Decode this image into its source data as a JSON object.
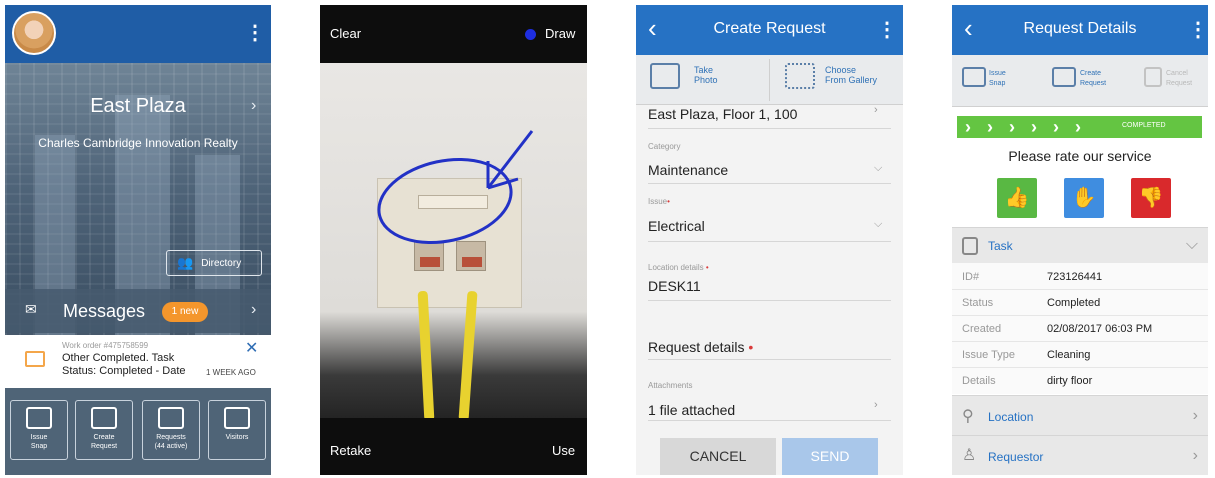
{
  "screen1": {
    "building_name": "East Plaza",
    "company": "Charles Cambridge Innovation Realty",
    "directory_label": "Directory",
    "messages_label": "Messages",
    "messages_badge": "1 new",
    "notification": {
      "work_order": "Work order #475758599",
      "line1": "Other Completed. Task",
      "line2": "Status: Completed - Date",
      "time": "1 WEEK AGO"
    },
    "tiles": [
      {
        "line1": "Issue",
        "line2": "Snap"
      },
      {
        "line1": "Create",
        "line2": "Request"
      },
      {
        "line1": "Requests",
        "line2": "(44 active)"
      },
      {
        "line1": "Visitors",
        "line2": ""
      }
    ]
  },
  "screen2": {
    "clear_label": "Clear",
    "draw_label": "Draw",
    "retake_label": "Retake",
    "use_label": "Use"
  },
  "screen3": {
    "title": "Create Request",
    "take_photo": [
      "Take",
      "Photo"
    ],
    "choose_gallery": [
      "Choose",
      "From Gallery"
    ],
    "location_value": "East Plaza, Floor 1, 100",
    "category_label": "Category",
    "category_value": "Maintenance",
    "issue_label": "Issue",
    "issue_value": "Electrical",
    "location_details_label": "Location details",
    "location_details_value": "DESK11",
    "request_details_label": "Request details",
    "attachments_label": "Attachments",
    "attachments_value": "1 file attached",
    "cancel_label": "CANCEL",
    "send_label": "SEND"
  },
  "screen4": {
    "title": "Request Details",
    "actions": [
      {
        "line1": "Issue",
        "line2": "Snap"
      },
      {
        "line1": "Create",
        "line2": "Request"
      },
      {
        "line1": "Cancel",
        "line2": "Request"
      }
    ],
    "progress_label": "COMPLETED",
    "rate_prompt": "Please rate our service",
    "task_label": "Task",
    "task": {
      "id_key": "ID#",
      "id_val": "723126441",
      "status_key": "Status",
      "status_val": "Completed",
      "created_key": "Created",
      "created_val": "02/08/2017 06:03 PM",
      "issue_type_key": "Issue Type",
      "issue_type_val": "Cleaning",
      "details_key": "Details",
      "details_val": "dirty floor"
    },
    "location_label": "Location",
    "requestor_label": "Requestor"
  },
  "colors": {
    "header_blue": "#2672c4",
    "accent_orange": "#f4962c",
    "progress_green": "#64c542",
    "thumb_up_green": "#59b843",
    "neutral_blue": "#3f8de0",
    "thumb_down_red": "#d9292c",
    "draw_blue": "#1e2ee0"
  }
}
